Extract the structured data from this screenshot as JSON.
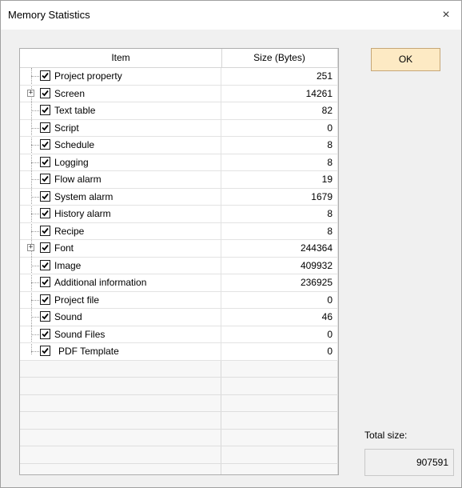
{
  "window": {
    "title": "Memory Statistics",
    "close_glyph": "×"
  },
  "columns": {
    "item": "Item",
    "size": "Size (Bytes)"
  },
  "rows": [
    {
      "label": "Project property",
      "size": "251",
      "expandable": false
    },
    {
      "label": "Screen",
      "size": "14261",
      "expandable": true
    },
    {
      "label": "Text table",
      "size": "82",
      "expandable": false
    },
    {
      "label": "Script",
      "size": "0",
      "expandable": false
    },
    {
      "label": "Schedule",
      "size": "8",
      "expandable": false
    },
    {
      "label": "Logging",
      "size": "8",
      "expandable": false
    },
    {
      "label": "Flow alarm",
      "size": "19",
      "expandable": false
    },
    {
      "label": "System alarm",
      "size": "1679",
      "expandable": false
    },
    {
      "label": "History alarm",
      "size": "8",
      "expandable": false
    },
    {
      "label": "Recipe",
      "size": "8",
      "expandable": false
    },
    {
      "label": "Font",
      "size": "244364",
      "expandable": true
    },
    {
      "label": "Image",
      "size": "409932",
      "expandable": false
    },
    {
      "label": "Additional information",
      "size": "236925",
      "expandable": false
    },
    {
      "label": "Project file",
      "size": "0",
      "expandable": false
    },
    {
      "label": "Sound",
      "size": "46",
      "expandable": false
    },
    {
      "label": "Sound Files",
      "size": "0",
      "expandable": false
    },
    {
      "label": "PDF Template",
      "size": "0",
      "expandable": false
    }
  ],
  "ok_button": {
    "label": "OK"
  },
  "total": {
    "label": "Total size:",
    "value": "907591"
  },
  "colors": {
    "ok_bg": "#fdeac4",
    "ok_border": "#c6a777"
  }
}
